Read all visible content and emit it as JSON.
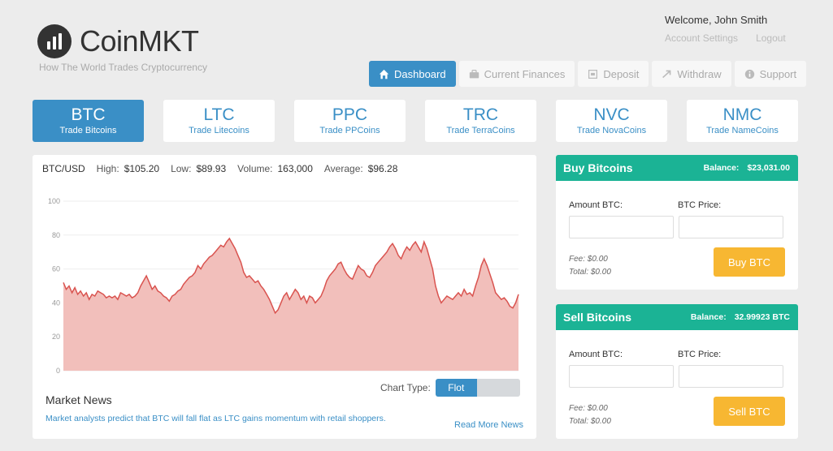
{
  "brand": {
    "name": "CoinMKT",
    "tagline": "How The World Trades Cryptocurrency"
  },
  "account": {
    "welcome": "Welcome, John Smith",
    "settings": "Account Settings",
    "logout": "Logout"
  },
  "nav": [
    {
      "label": "Dashboard",
      "icon": "home-icon",
      "active": true
    },
    {
      "label": "Current Finances",
      "icon": "briefcase-icon"
    },
    {
      "label": "Deposit",
      "icon": "deposit-icon"
    },
    {
      "label": "Withdraw",
      "icon": "arrow-icon"
    },
    {
      "label": "Support",
      "icon": "info-icon"
    }
  ],
  "coins": [
    {
      "symbol": "BTC",
      "label": "Trade Bitcoins",
      "active": true
    },
    {
      "symbol": "LTC",
      "label": "Trade Litecoins"
    },
    {
      "symbol": "PPC",
      "label": "Trade PPCoins"
    },
    {
      "symbol": "TRC",
      "label": "Trade TerraCoins"
    },
    {
      "symbol": "NVC",
      "label": "Trade NovaCoins"
    },
    {
      "symbol": "NMC",
      "label": "Trade NameCoins"
    }
  ],
  "stats": {
    "pair": "BTC/USD",
    "high_label": "High:",
    "high": "$105.20",
    "low_label": "Low:",
    "low": "$89.93",
    "volume_label": "Volume:",
    "volume": "163,000",
    "avg_label": "Average:",
    "avg": "$96.28"
  },
  "chart_data": {
    "type": "area",
    "ylim": [
      0,
      100
    ],
    "yticks": [
      0,
      20,
      40,
      60,
      80,
      100
    ],
    "color": "#d9534f",
    "fill": "#f2bfbb",
    "values": [
      52,
      48,
      50,
      46,
      49,
      45,
      47,
      44,
      46,
      42,
      45,
      44,
      47,
      46,
      45,
      43,
      44,
      43,
      44,
      42,
      46,
      45,
      44,
      45,
      43,
      44,
      46,
      50,
      53,
      56,
      52,
      48,
      50,
      47,
      46,
      44,
      43,
      41,
      44,
      45,
      47,
      48,
      51,
      53,
      55,
      56,
      58,
      62,
      60,
      63,
      65,
      67,
      68,
      70,
      72,
      74,
      73,
      76,
      78,
      75,
      72,
      68,
      64,
      58,
      55,
      56,
      54,
      52,
      53,
      50,
      48,
      45,
      42,
      38,
      34,
      36,
      40,
      44,
      46,
      42,
      45,
      48,
      46,
      42,
      44,
      40,
      44,
      43,
      40,
      42,
      44,
      48,
      53,
      56,
      58,
      60,
      63,
      64,
      60,
      57,
      55,
      54,
      58,
      62,
      60,
      59,
      56,
      55,
      58,
      62,
      64,
      66,
      68,
      70,
      73,
      75,
      72,
      68,
      66,
      70,
      73,
      71,
      74,
      76,
      73,
      70,
      76,
      72,
      66,
      60,
      50,
      44,
      40,
      42,
      44,
      43,
      42,
      44,
      46,
      44,
      48,
      45,
      46,
      44,
      50,
      55,
      62,
      66,
      62,
      57,
      52,
      46,
      44,
      42,
      43,
      41,
      38,
      37,
      40,
      45
    ],
    "chart_type_label": "Chart Type:",
    "chart_type_value": "Flot"
  },
  "news": {
    "title": "Market News",
    "text": "Market analysts predict that BTC will fall flat as LTC gains momentum with retail shoppers.",
    "read_more": "Read More News"
  },
  "buy": {
    "title": "Buy Bitcoins",
    "balance_label": "Balance:",
    "balance": "$23,031.00",
    "amount_label": "Amount BTC:",
    "price_label": "BTC Price:",
    "fee": "Fee: $0.00",
    "total": "Total: $0.00",
    "button": "Buy BTC"
  },
  "sell": {
    "title": "Sell Bitcoins",
    "balance_label": "Balance:",
    "balance": "32.99923 BTC",
    "amount_label": "Amount BTC:",
    "price_label": "BTC Price:",
    "fee": "Fee: $0.00",
    "total": "Total: $0.00",
    "button": "Sell BTC"
  },
  "colors": {
    "primary": "#3a8fc6",
    "accent": "#1bb395",
    "button": "#f7b732",
    "background": "#ececec"
  }
}
